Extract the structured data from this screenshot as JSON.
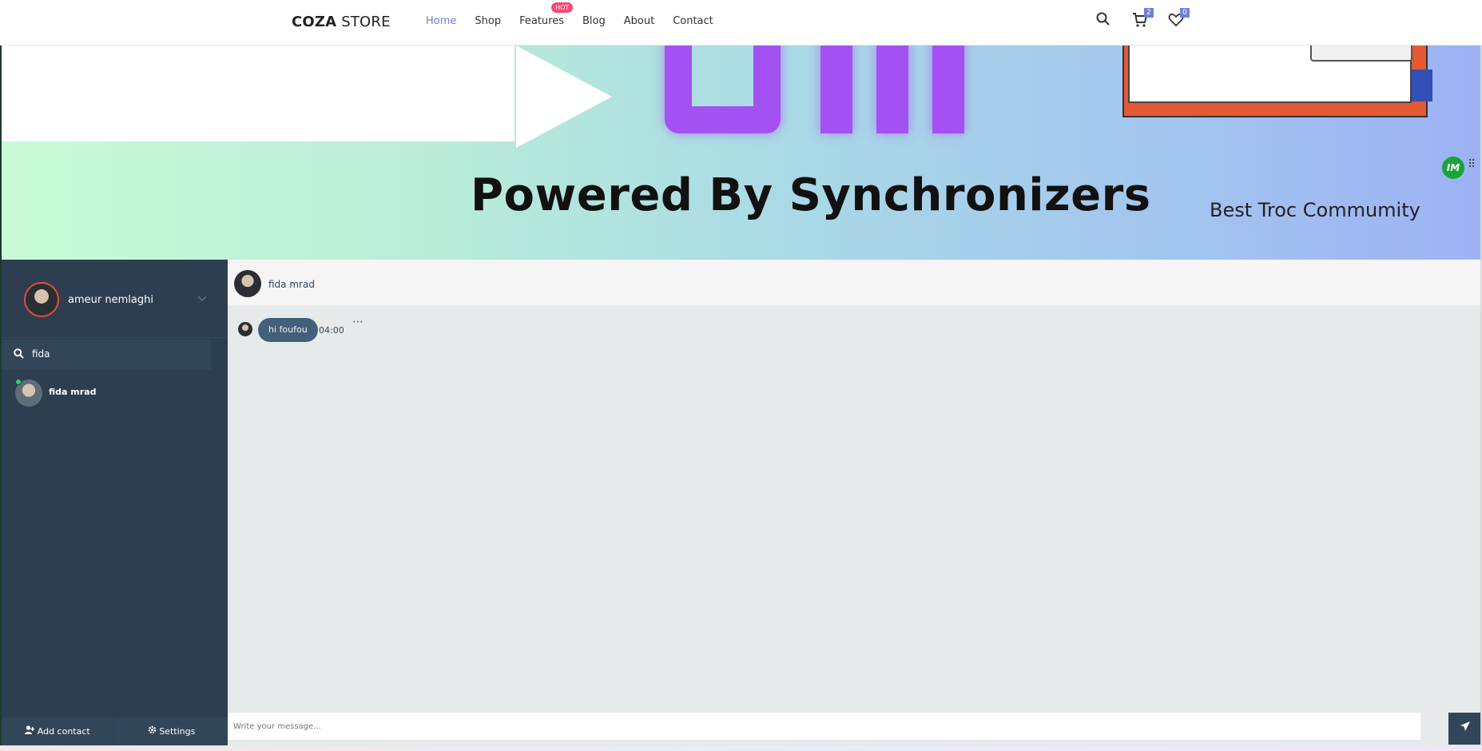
{
  "header": {
    "logo_bold": "COZA",
    "logo_light": " STORE",
    "nav": [
      {
        "label": "Home",
        "active": true
      },
      {
        "label": "Shop",
        "active": false
      },
      {
        "label": "Features",
        "active": false,
        "badge": "HOT"
      },
      {
        "label": "Blog",
        "active": false
      },
      {
        "label": "About",
        "active": false
      },
      {
        "label": "Contact",
        "active": false
      }
    ],
    "cart_count": "2",
    "wishlist_count": "0",
    "icons": [
      "search-icon",
      "cart-icon",
      "heart-icon"
    ]
  },
  "banner": {
    "headline": "Powered By Synchronizers",
    "tagline": "Best Troc Commumity",
    "widget_label": "IM"
  },
  "chat": {
    "user_name": "ameur nemlaghi",
    "search_value": "fida",
    "contacts": [
      {
        "name": "fida mrad",
        "online": true
      }
    ],
    "active_contact": "fida mrad",
    "messages": [
      {
        "text": "hi foufou",
        "time": "04:00"
      }
    ],
    "more_label": "⋯",
    "composer_placeholder": "Write your message...",
    "add_contact_label": "Add contact",
    "settings_label": "Settings"
  },
  "colors": {
    "accent": "#717fe0",
    "hot_badge": "#f74877",
    "sidebar_bg": "#2c3e50",
    "bubble_bg": "#435f7a",
    "online": "#2ecc71"
  }
}
